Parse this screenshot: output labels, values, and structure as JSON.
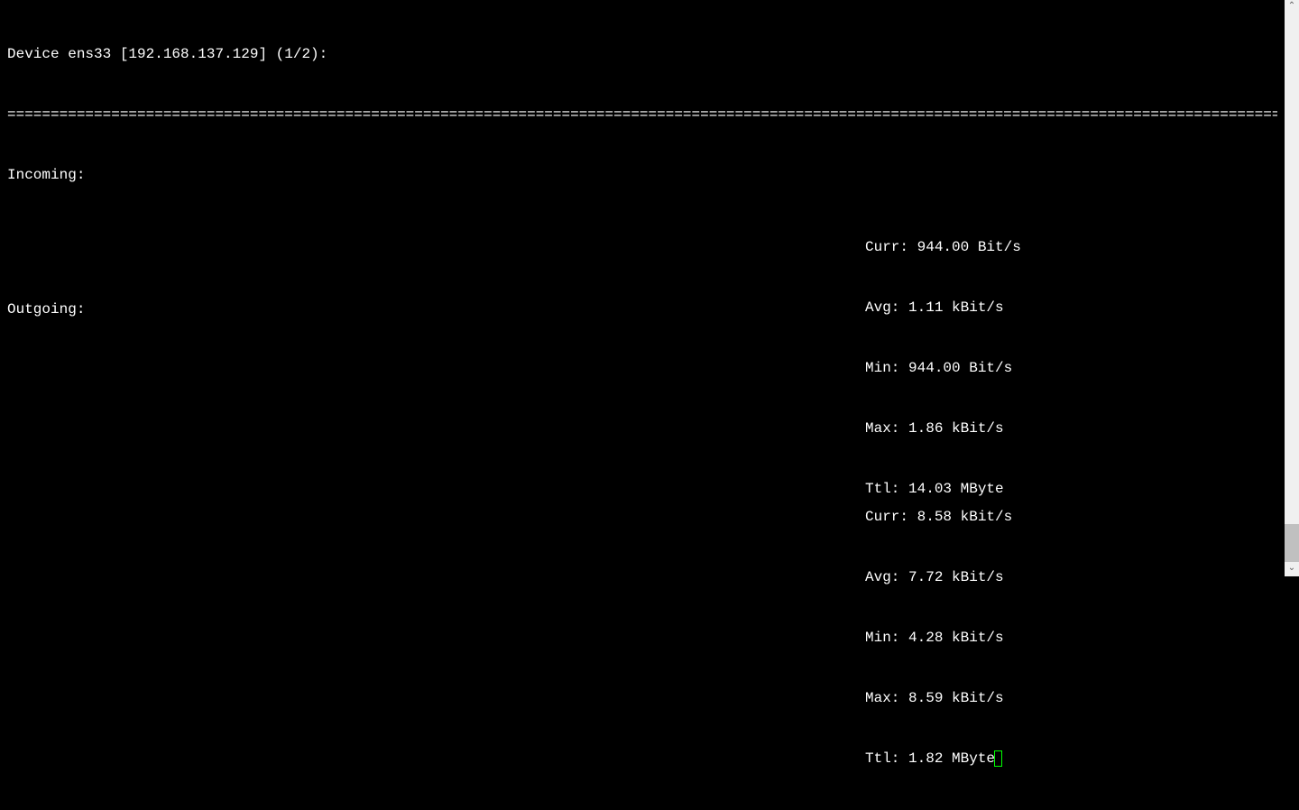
{
  "header": {
    "device_prefix": "Device",
    "device_name": "ens33",
    "ip": "[192.168.137.129]",
    "index": "(1/2):",
    "full_line": "Device ens33 [192.168.137.129] (1/2):"
  },
  "divider": "============================================================================================================================================================",
  "incoming": {
    "label": "Incoming:",
    "stats": {
      "curr": "Curr: 944.00 Bit/s",
      "avg": "Avg: 1.11 kBit/s",
      "min": "Min: 944.00 Bit/s",
      "max": "Max: 1.86 kBit/s",
      "ttl": "Ttl: 14.03 MByte"
    }
  },
  "outgoing": {
    "label": "Outgoing:",
    "stats": {
      "curr": "Curr: 8.58 kBit/s",
      "avg": "Avg: 7.72 kBit/s",
      "min": "Min: 4.28 kBit/s",
      "max": "Max: 8.59 kBit/s",
      "ttl": "Ttl: 1.82 MByte"
    }
  }
}
